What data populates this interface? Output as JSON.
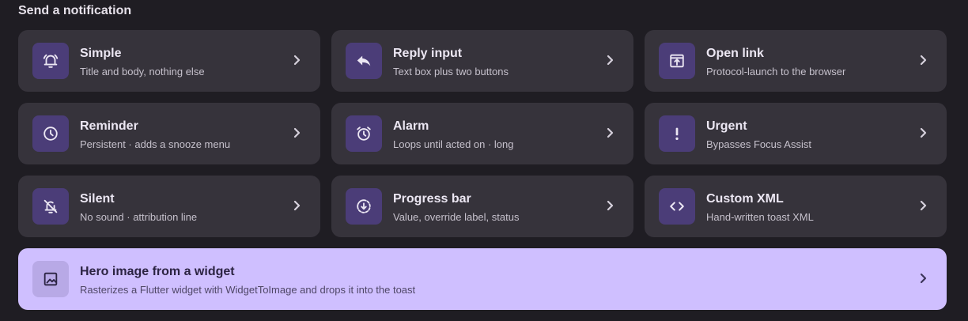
{
  "section": {
    "title": "Send a notification"
  },
  "colors": {
    "background": "#1f1d23",
    "card": "#36333b",
    "icon_tile": "#4b3d78",
    "icon_glyph": "#ece7f3",
    "hero_card": "#cfbfff",
    "hero_icon_tile": "#b8a9e6",
    "hero_icon_glyph": "#2c2443"
  },
  "cards": [
    {
      "title": "Simple",
      "subtitle": "Title and body, nothing else",
      "icon": "bell-ring-icon"
    },
    {
      "title": "Reply input",
      "subtitle": "Text box plus two buttons",
      "icon": "reply-icon"
    },
    {
      "title": "Open link",
      "subtitle": "Protocol-launch to the browser",
      "icon": "open-in-browser-icon"
    },
    {
      "title": "Reminder",
      "subtitle": "Persistent · adds a snooze menu",
      "icon": "clock-icon"
    },
    {
      "title": "Alarm",
      "subtitle": "Loops until acted on · long",
      "icon": "alarm-clock-icon"
    },
    {
      "title": "Urgent",
      "subtitle": "Bypasses Focus Assist",
      "icon": "exclamation-icon"
    },
    {
      "title": "Silent",
      "subtitle": "No sound · attribution line",
      "icon": "bell-off-icon"
    },
    {
      "title": "Progress bar",
      "subtitle": "Value, override label, status",
      "icon": "progress-download-icon"
    },
    {
      "title": "Custom XML",
      "subtitle": "Hand-written toast XML",
      "icon": "code-icon"
    }
  ],
  "hero": {
    "title": "Hero image from a widget",
    "subtitle": "Rasterizes a Flutter widget with WidgetToImage and drops it into the toast",
    "icon": "image-icon"
  }
}
